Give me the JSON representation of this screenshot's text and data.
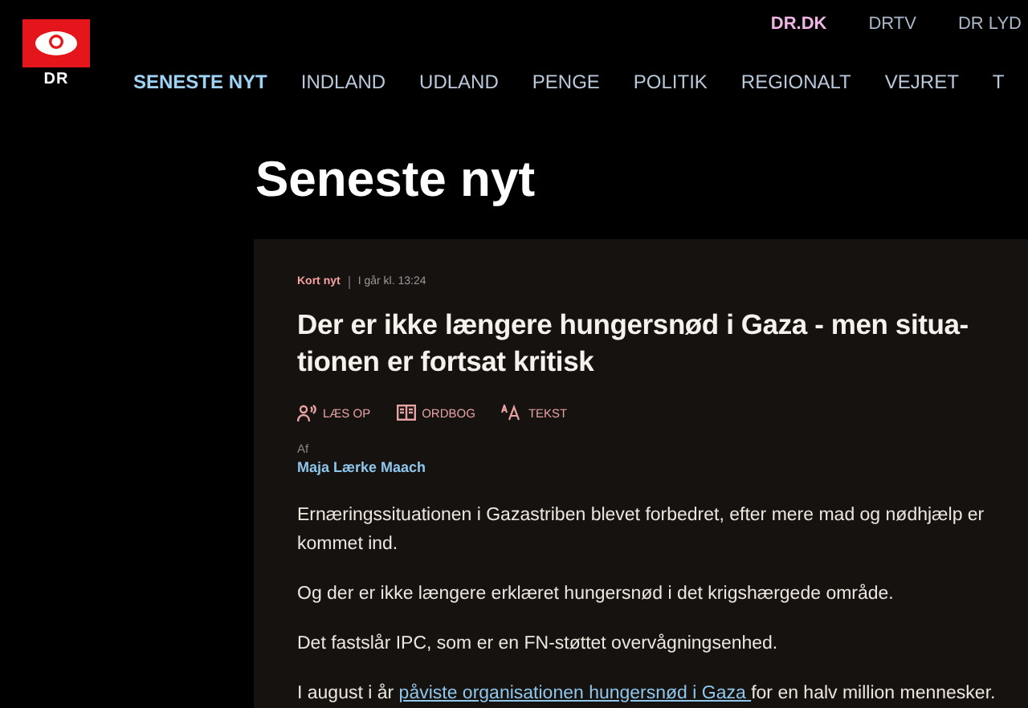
{
  "top_links": [
    {
      "label": "DR.DK",
      "selected": true
    },
    {
      "label": "DRTV",
      "selected": false
    },
    {
      "label": "DR LYD",
      "selected": false
    }
  ],
  "logo": {
    "text": "DR"
  },
  "nav": [
    {
      "label": "SENESTE NYT",
      "selected": true
    },
    {
      "label": "INDLAND",
      "selected": false
    },
    {
      "label": "UDLAND",
      "selected": false
    },
    {
      "label": "PENGE",
      "selected": false
    },
    {
      "label": "POLITIK",
      "selected": false
    },
    {
      "label": "REGIONALT",
      "selected": false
    },
    {
      "label": "VEJRET",
      "selected": false
    },
    {
      "label": "T",
      "selected": false
    }
  ],
  "page_title": "Seneste nyt",
  "article": {
    "category": "Kort nyt",
    "time": "I går kl. 13:24",
    "headline_lines": [
      "Der er ikke længere hungersnød i Gaza - men situa-",
      "tionen er fortsat kritisk"
    ],
    "tools": [
      {
        "kind": "read",
        "label": "LÆS OP"
      },
      {
        "kind": "dictionary",
        "label": "ORDBOG"
      },
      {
        "kind": "text",
        "label": "TEKST"
      }
    ],
    "byline_label": "Af",
    "author": "Maja Lærke Maach",
    "paragraphs": [
      {
        "text": "Ernæringssituationen i Gazastriben blevet forbedret, efter mere mad og nødhjælp er kommet ind."
      },
      {
        "text": "Og der er ikke længere erklæret hungersnød i det krigshærgede område."
      },
      {
        "text": "Det fastslår IPC, som er en FN-støttet overvågningsenhed."
      },
      {
        "text": "I august i år ",
        "link": "påviste organisationen hungersnød i Gaza ",
        "after": "for en halv million mennesker."
      }
    ]
  }
}
